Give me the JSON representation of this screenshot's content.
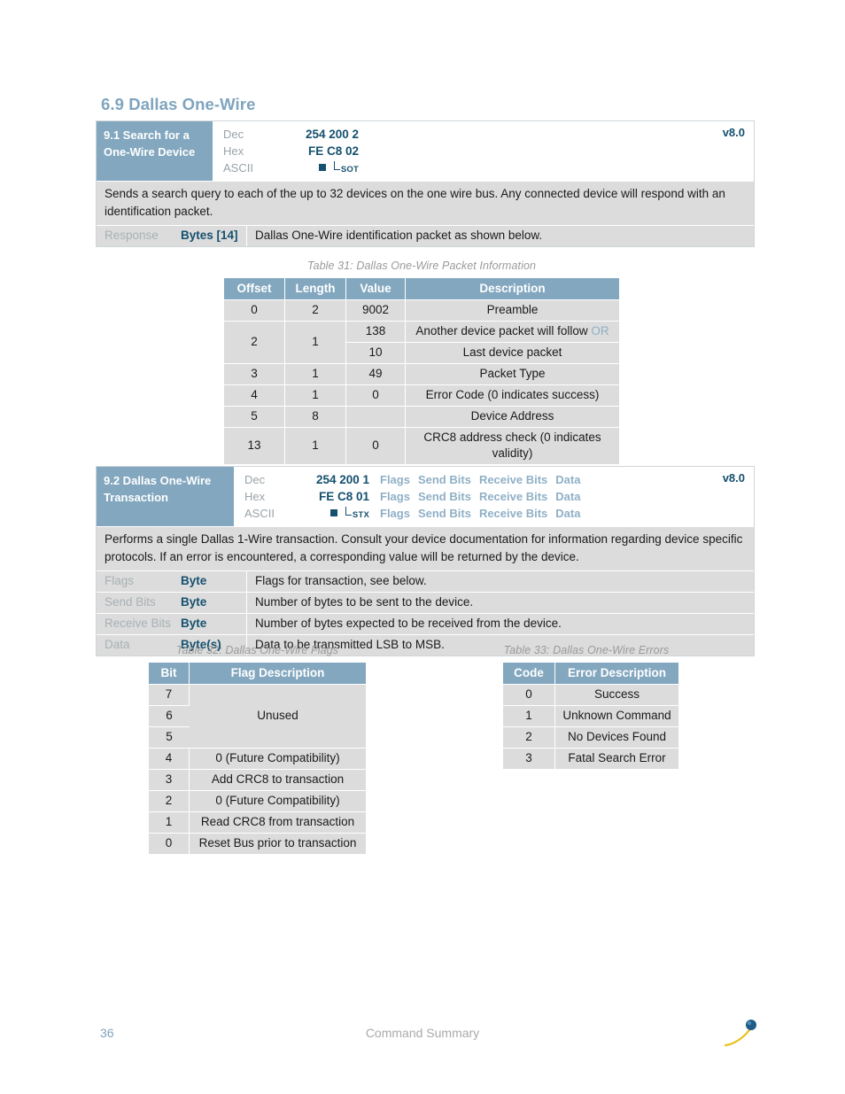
{
  "document": {
    "section_heading": "6.9 Dallas One-Wire",
    "footer": {
      "page_number": "36",
      "title": "Command Summary",
      "logo_name": "company-logo"
    }
  },
  "colors": {
    "header_blue": "#82A7BF",
    "table_row_gray": "#DCDCDC",
    "dark_blue_text": "#15506E",
    "light_blue_text": "#8FB0C6",
    "muted_label": "#9AA3A8",
    "heading_blue": "#7FA4BE"
  },
  "command_9_1": {
    "title_line1": "9.1 Search for a",
    "title_line2": "One-Wire Device",
    "version": "v8.0",
    "rows": {
      "dec_label": "Dec",
      "dec_value": "254 200 2",
      "hex_label": "Hex",
      "hex_value": "FE C8 02",
      "ascii_label": "ASCII",
      "ascii_glyph1": "filled-square",
      "ascii_glyph2": "SOT"
    },
    "description": "Sends a search query to each of the up to 32 devices on the one wire bus.  Any connected device will respond with an identification packet.",
    "response": {
      "name": "Response",
      "type": "Bytes [14]",
      "desc": "Dallas One-Wire identification packet as shown below."
    }
  },
  "table_31": {
    "caption": "Table 31: Dallas One-Wire Packet Information",
    "headers": [
      "Offset",
      "Length",
      "Value",
      "Description"
    ],
    "rows": [
      {
        "offset": "0",
        "length": "2",
        "value": "9002",
        "description": "Preamble"
      },
      {
        "offset": "2",
        "length": "1",
        "value": "138",
        "description": "Another device packet will follow ",
        "description_suffix": "OR",
        "rowspan": 2
      },
      {
        "offset": "",
        "length": "",
        "value": "10",
        "description": "Last device packet"
      },
      {
        "offset": "3",
        "length": "1",
        "value": "49",
        "description": "Packet Type"
      },
      {
        "offset": "4",
        "length": "1",
        "value": "0",
        "description": "Error Code (0 indicates success)"
      },
      {
        "offset": "5",
        "length": "8",
        "value": "",
        "description": "Device Address"
      },
      {
        "offset": "13",
        "length": "1",
        "value": "0",
        "description": "CRC8 address check (0 indicates validity)"
      }
    ]
  },
  "command_9_2": {
    "title_line1": "9.2 Dallas One-Wire",
    "title_line2": "Transaction",
    "version": "v8.0",
    "params_inline": [
      "Flags",
      "Send Bits",
      "Receive Bits",
      "Data"
    ],
    "rows": {
      "dec_label": "Dec",
      "dec_value": "254 200 1",
      "hex_label": "Hex",
      "hex_value": "FE C8 01",
      "ascii_label": "ASCII",
      "ascii_glyph1": "filled-square",
      "ascii_glyph2": "STX"
    },
    "description": "Performs a single Dallas 1-Wire transaction.  Consult your device documentation for information regarding device specific protocols.  If an error is encountered, a corresponding value will be returned by the device.",
    "parameters": [
      {
        "name": "Flags",
        "type": "Byte",
        "desc": "Flags for transaction, see below."
      },
      {
        "name": "Send Bits",
        "type": "Byte",
        "desc": "Number of bytes to be sent to the device."
      },
      {
        "name": "Receive Bits",
        "type": "Byte",
        "desc": "Number of bytes expected to be received from the device."
      },
      {
        "name": "Data",
        "type": "Byte(s)",
        "desc": "Data to be transmitted LSB to MSB."
      }
    ]
  },
  "table_32": {
    "caption": "Table 32: Dallas One-Wire Flags",
    "headers": [
      "Bit",
      "Flag Description"
    ],
    "rows": [
      {
        "bit": "7",
        "flag": "",
        "merged_start": true,
        "merged_label": "Unused",
        "rowspan": 3
      },
      {
        "bit": "6",
        "flag": ""
      },
      {
        "bit": "5",
        "flag": ""
      },
      {
        "bit": "4",
        "flag": "0 (Future Compatibility)"
      },
      {
        "bit": "3",
        "flag": "Add CRC8 to transaction"
      },
      {
        "bit": "2",
        "flag": "0 (Future Compatibility)"
      },
      {
        "bit": "1",
        "flag": "Read CRC8 from transaction"
      },
      {
        "bit": "0",
        "flag": "Reset Bus prior to transaction"
      }
    ]
  },
  "table_33": {
    "caption": "Table 33: Dallas One-Wire Errors",
    "headers": [
      "Code",
      "Error Description"
    ],
    "rows": [
      {
        "code": "0",
        "error": "Success"
      },
      {
        "code": "1",
        "error": "Unknown Command"
      },
      {
        "code": "2",
        "error": "No Devices Found"
      },
      {
        "code": "3",
        "error": "Fatal Search Error"
      }
    ]
  }
}
